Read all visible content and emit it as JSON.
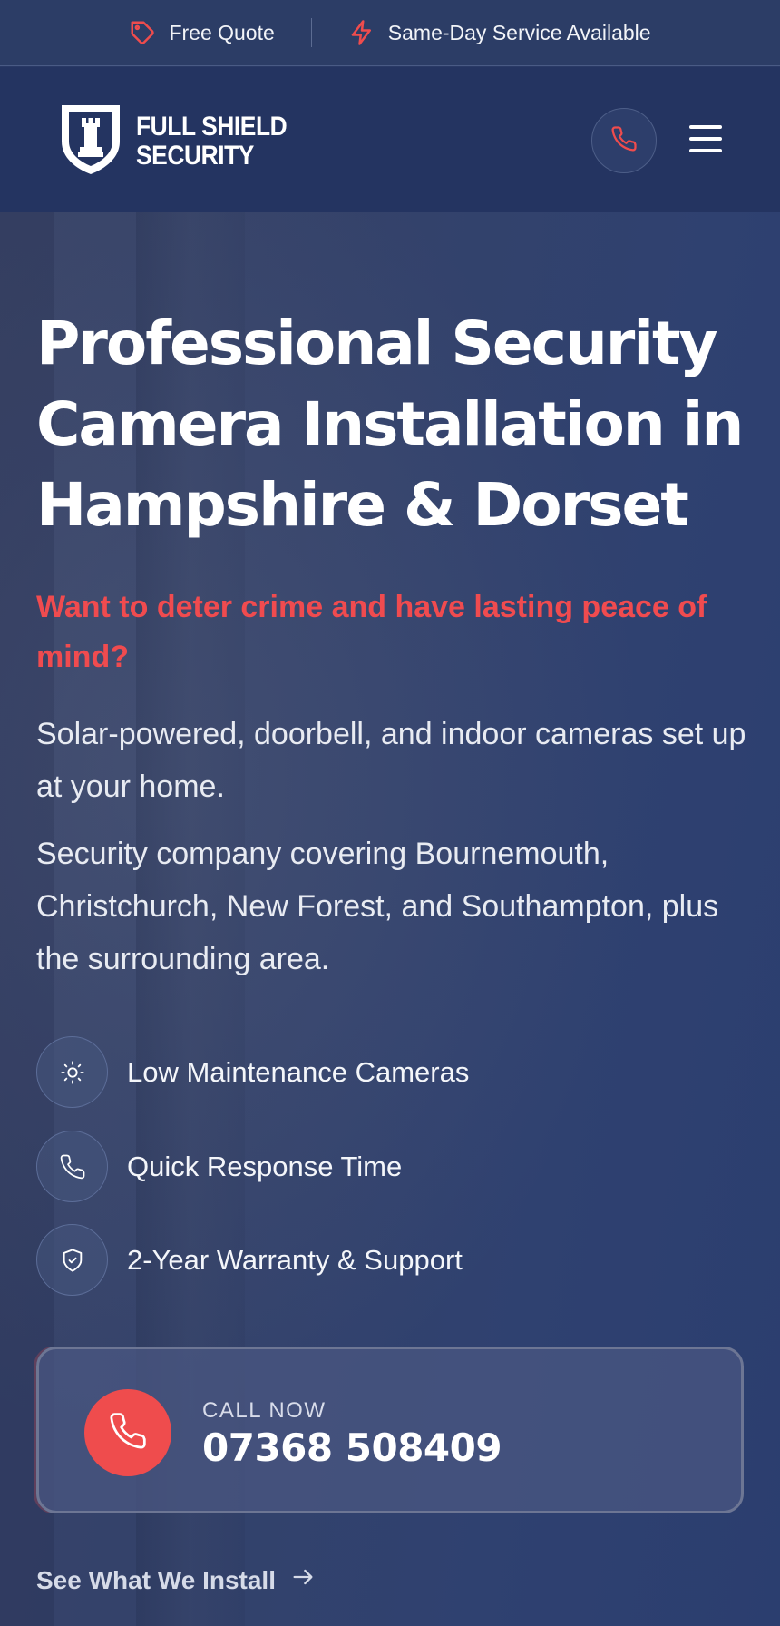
{
  "topbar": {
    "items": [
      {
        "label": "Free Quote",
        "icon": "tag-icon"
      },
      {
        "label": "Same-Day Service Available",
        "icon": "lightning-icon"
      }
    ]
  },
  "header": {
    "logo_line1": "FULL SHIELD",
    "logo_line2": "SECURITY",
    "logo_icon": "shield-rook-icon",
    "phone_icon": "phone-icon",
    "menu_icon": "hamburger-menu-icon"
  },
  "hero": {
    "title": "Professional Security Camera Installation in Hampshire & Dorset",
    "tagline": "Want to deter crime and have lasting peace of mind?",
    "paragraph1": "Solar-powered, doorbell, and indoor cameras set up at your home.",
    "paragraph2": "Security company covering Bournemouth, Christchurch, New Forest, and Southampton, plus the surrounding area.",
    "features": [
      {
        "label": "Low Maintenance Cameras",
        "icon": "sun-icon"
      },
      {
        "label": "Quick Response Time",
        "icon": "phone-icon"
      },
      {
        "label": "2-Year Warranty & Support",
        "icon": "shield-check-icon"
      }
    ],
    "call": {
      "label": "CALL NOW",
      "number": "07368 508409",
      "icon": "phone-icon"
    },
    "link": {
      "label": "See What We Install",
      "icon": "arrow-right-icon"
    }
  },
  "colors": {
    "accent": "#ef4c4d",
    "header_bg": "#243461",
    "topbar_bg": "#2c3d66",
    "hero_bg": "#34426a",
    "text": "#ffffff"
  }
}
